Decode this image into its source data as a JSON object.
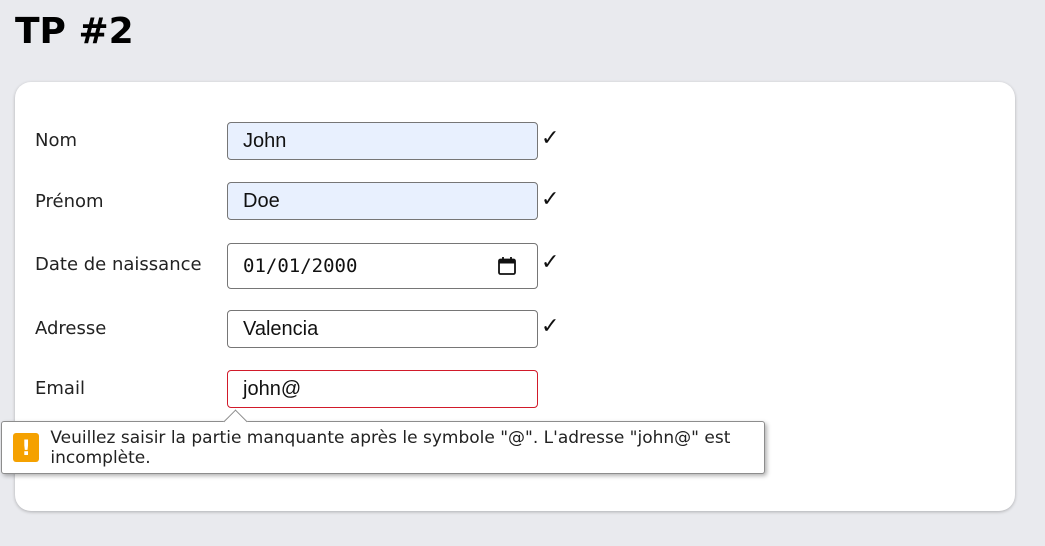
{
  "title": "TP #2",
  "form": {
    "nom": {
      "label": "Nom",
      "value": "John",
      "valid_mark": "✓"
    },
    "prenom": {
      "label": "Prénom",
      "value": "Doe",
      "valid_mark": "✓"
    },
    "date": {
      "label": "Date de naissance",
      "value": "01/01/2000",
      "valid_mark": "✓"
    },
    "adresse": {
      "label": "Adresse",
      "value": "Valencia",
      "valid_mark": "✓"
    },
    "email": {
      "label": "Email",
      "value": "john@"
    }
  },
  "validation": {
    "icon": "warning-icon",
    "icon_glyph": "!",
    "message": "Veuillez saisir la partie manquante après le symbole \"@\". L'adresse \"john@\" est incomplète.",
    "color": "#f5a100"
  },
  "colors": {
    "error_border": "#d11a2a",
    "autofill_bg": "#e8f0fe"
  }
}
